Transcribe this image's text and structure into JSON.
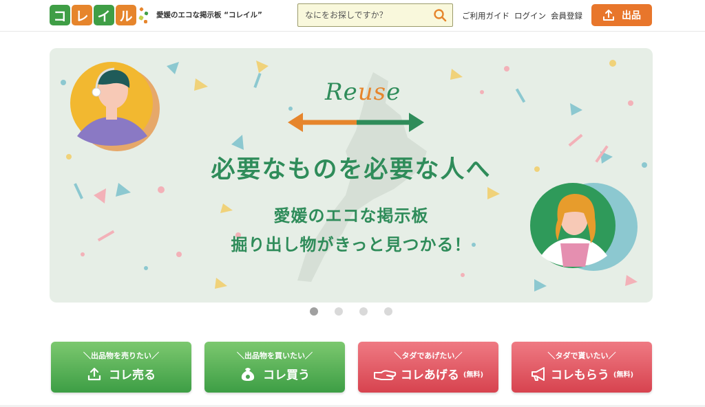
{
  "header": {
    "logo_chars": [
      "コ",
      "レ",
      "イ",
      "ル"
    ],
    "logo_colors": [
      "#3f9e46",
      "#e6852c",
      "#3f9e46",
      "#e6852c"
    ],
    "tagline": "愛媛のエコな掲示板 “コレイル”",
    "search": {
      "placeholder": "なにをお探しですか？"
    },
    "nav": {
      "guide": "ご利用ガイド",
      "login": "ログイン",
      "register": "会員登録"
    },
    "listing_button": "出品"
  },
  "banner": {
    "reuse_prefix": "Re",
    "reuse_highlight": "us",
    "reuse_suffix": "e",
    "headline": "必要なものを必要な人へ",
    "subline1": "愛媛のエコな掲示板",
    "subline2": "掘り出し物がきっと見つかる！",
    "slide_count": 4,
    "active_slide": 1
  },
  "actions": [
    {
      "sub": "＼出品物を売りたい／",
      "label": "コレ売る",
      "free": "",
      "icon": "upload-icon",
      "color": "green"
    },
    {
      "sub": "＼出品物を買いたい／",
      "label": "コレ買う",
      "free": "",
      "icon": "money-bag-icon",
      "color": "green"
    },
    {
      "sub": "＼タダであげたい／",
      "label": "コレあげる",
      "free": "(無料)",
      "icon": "give-hand-icon",
      "color": "red"
    },
    {
      "sub": "＼タダで貰いたい／",
      "label": "コレもらう",
      "free": "(無料)",
      "icon": "megaphone-icon",
      "color": "red"
    }
  ],
  "colors": {
    "brand_green": "#2f8c5a",
    "brand_orange": "#e8762b",
    "button_red": "#d7434f",
    "button_green": "#3d9e45"
  }
}
